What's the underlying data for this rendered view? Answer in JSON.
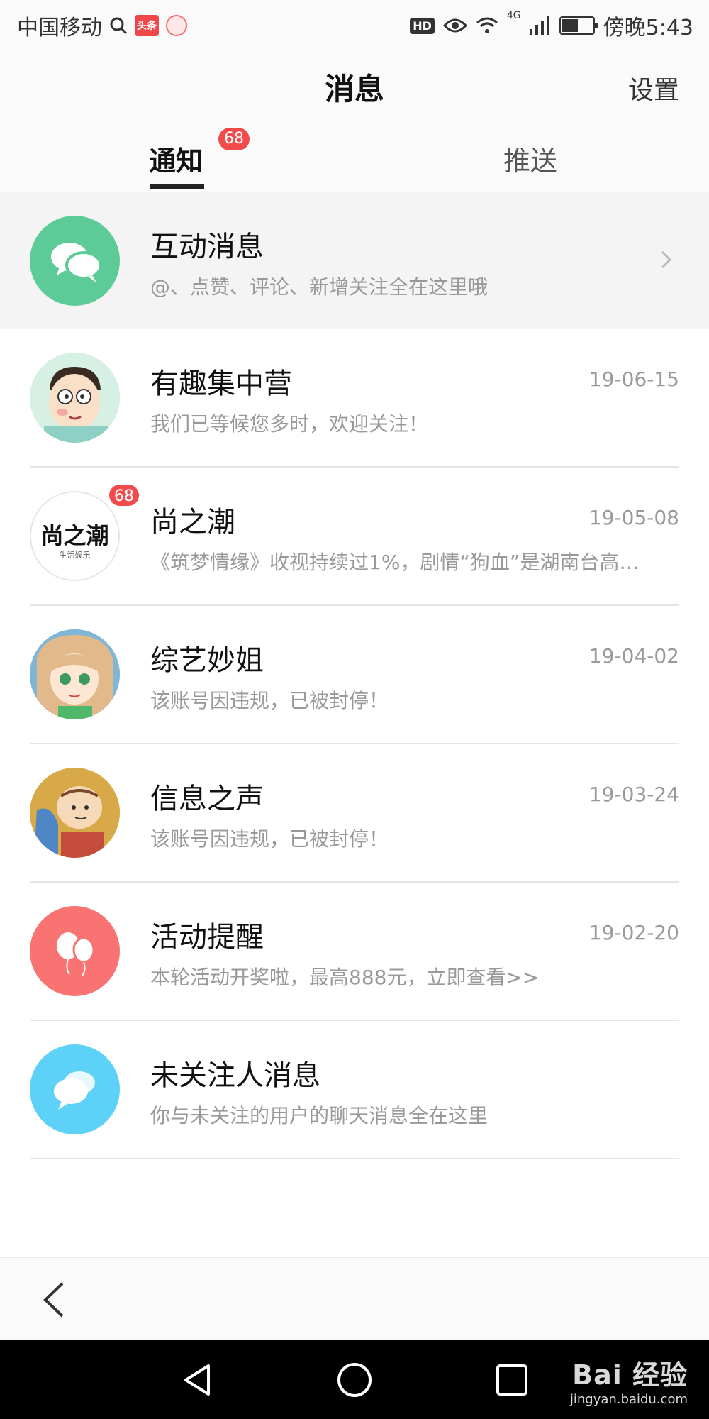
{
  "status_bar": {
    "carrier": "中国移动",
    "app_mini_label": "头条",
    "hd": "HD",
    "network": "4G",
    "time": "傍晚5:43"
  },
  "header": {
    "title": "消息",
    "settings_label": "设置"
  },
  "tabs": [
    {
      "label": "通知",
      "badge": "68",
      "active": true
    },
    {
      "label": "推送",
      "active": false
    }
  ],
  "messages": [
    {
      "name": "互动消息",
      "preview": "@、点赞、评论、新增关注全在这里哦",
      "date": "",
      "icon": "chat-bubbles-icon",
      "color": "#5dcb98"
    },
    {
      "name": "有趣集中营",
      "preview": "我们已等候您多时，欢迎关注！",
      "date": "19-06-15",
      "icon": "cartoon-avatar"
    },
    {
      "name": "尚之潮",
      "preview": "《筑梦情缘》收视持续过1%，剧情“狗血”是湖南台高…",
      "date": "19-05-08",
      "icon": "logo-avatar",
      "logo_text": "尚之潮",
      "logo_sub": "生活娱乐",
      "badge": "68"
    },
    {
      "name": "综艺妙姐",
      "preview": "该账号因违规，已被封停！",
      "date": "19-04-02",
      "icon": "anime-girl-avatar"
    },
    {
      "name": "信息之声",
      "preview": "该账号因违规，已被封停！",
      "date": "19-03-24",
      "icon": "cartoon-boy-avatar"
    },
    {
      "name": "活动提醒",
      "preview": "本轮活动开奖啦，最高888元，立即查看>>",
      "date": "19-02-20",
      "icon": "balloons-icon",
      "color": "#f87371"
    },
    {
      "name": "未关注人消息",
      "preview": "你与未关注的用户的聊天消息全在这里",
      "date": "",
      "icon": "chat-bubble-icon",
      "color": "#5ed1f8"
    }
  ],
  "watermark": {
    "main": "Bai 经验",
    "sub": "jingyan.baidu.com"
  }
}
